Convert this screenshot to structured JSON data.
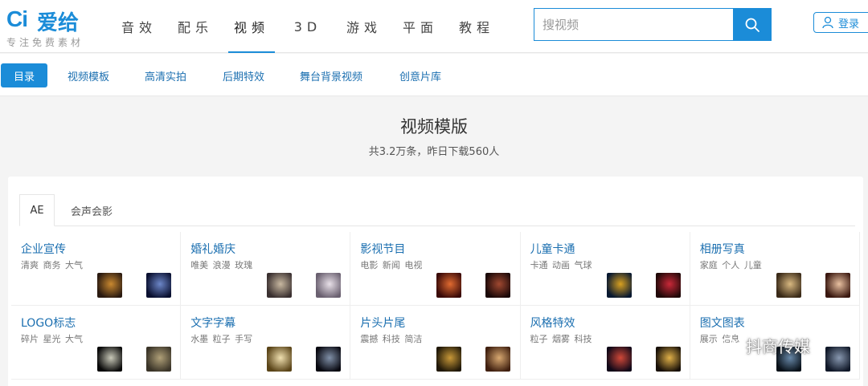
{
  "logo": {
    "mark": "Ci",
    "name": "爱给",
    "slogan": "专注免费素材"
  },
  "nav": {
    "items": [
      {
        "label": "音效",
        "active": false
      },
      {
        "label": "配乐",
        "active": false
      },
      {
        "label": "视频",
        "active": true
      },
      {
        "label": "3D",
        "active": false
      },
      {
        "label": "游戏",
        "active": false
      },
      {
        "label": "平面",
        "active": false
      },
      {
        "label": "教程",
        "active": false
      }
    ]
  },
  "search": {
    "placeholder": "搜视频",
    "icon": "search-icon"
  },
  "login": {
    "label": "登录",
    "icon": "user-icon"
  },
  "subnav": {
    "items": [
      {
        "label": "目录",
        "active": true
      },
      {
        "label": "视频模板",
        "active": false
      },
      {
        "label": "高清实拍",
        "active": false
      },
      {
        "label": "后期特效",
        "active": false
      },
      {
        "label": "舞台背景视频",
        "active": false
      },
      {
        "label": "创意片库",
        "active": false
      }
    ]
  },
  "page": {
    "title": "视频模版",
    "subtitle": "共3.2万条，昨日下载560人"
  },
  "tabs": [
    {
      "label": "AE",
      "active": true
    },
    {
      "label": "会声会影",
      "active": false
    }
  ],
  "categories": [
    {
      "name": "企业宣传",
      "tags": "清爽 商务 大气",
      "thumbs": [
        [
          "#2a1a10",
          "#c9882f"
        ],
        [
          "#0a1030",
          "#6c86c8"
        ]
      ]
    },
    {
      "name": "婚礼婚庆",
      "tags": "唯美 浪漫 玫瑰",
      "thumbs": [
        [
          "#3a3030",
          "#c8b8a0"
        ],
        [
          "#6a6070",
          "#e8e0e8"
        ]
      ]
    },
    {
      "name": "影视节目",
      "tags": "电影 新闻 电视",
      "thumbs": [
        [
          "#3a0a08",
          "#e06a30"
        ],
        [
          "#1a0808",
          "#a04830"
        ]
      ]
    },
    {
      "name": "儿童卡通",
      "tags": "卡通 动画 气球",
      "thumbs": [
        [
          "#081830",
          "#d8a020"
        ],
        [
          "#200808",
          "#c82838"
        ]
      ]
    },
    {
      "name": "相册写真",
      "tags": "家庭 个人 儿童",
      "thumbs": [
        [
          "#3a2a18",
          "#d8b880"
        ],
        [
          "#3a1810",
          "#e8c0a0"
        ]
      ]
    },
    {
      "name": "LOGO标志",
      "tags": "碎片 星光 大气",
      "thumbs": [
        [
          "#080808",
          "#c8c8b8"
        ],
        [
          "#3a3428",
          "#b0a078"
        ]
      ]
    },
    {
      "name": "文字字幕",
      "tags": "水墨 粒子 手写",
      "thumbs": [
        [
          "#5a4418",
          "#f0e0b0"
        ],
        [
          "#080810",
          "#8090a8"
        ]
      ]
    },
    {
      "name": "片头片尾",
      "tags": "震撼 科技 简洁",
      "thumbs": [
        [
          "#201808",
          "#c89838"
        ],
        [
          "#402010",
          "#d8a870"
        ]
      ]
    },
    {
      "name": "风格特效",
      "tags": "粒子 烟雾 科技",
      "thumbs": [
        [
          "#100818",
          "#d04838"
        ],
        [
          "#181008",
          "#e0b048"
        ]
      ]
    },
    {
      "name": "图文图表",
      "tags": "展示 信息",
      "thumbs": [
        [
          "#081018",
          "#6888a8"
        ],
        [
          "#101828",
          "#8898b0"
        ]
      ]
    }
  ],
  "watermark": {
    "text": "抖商传媒",
    "icon": "wechat-icon"
  },
  "colors": {
    "accent": "#1b8cd8",
    "link": "#1b6fb0",
    "background": "#f4f4f4"
  }
}
